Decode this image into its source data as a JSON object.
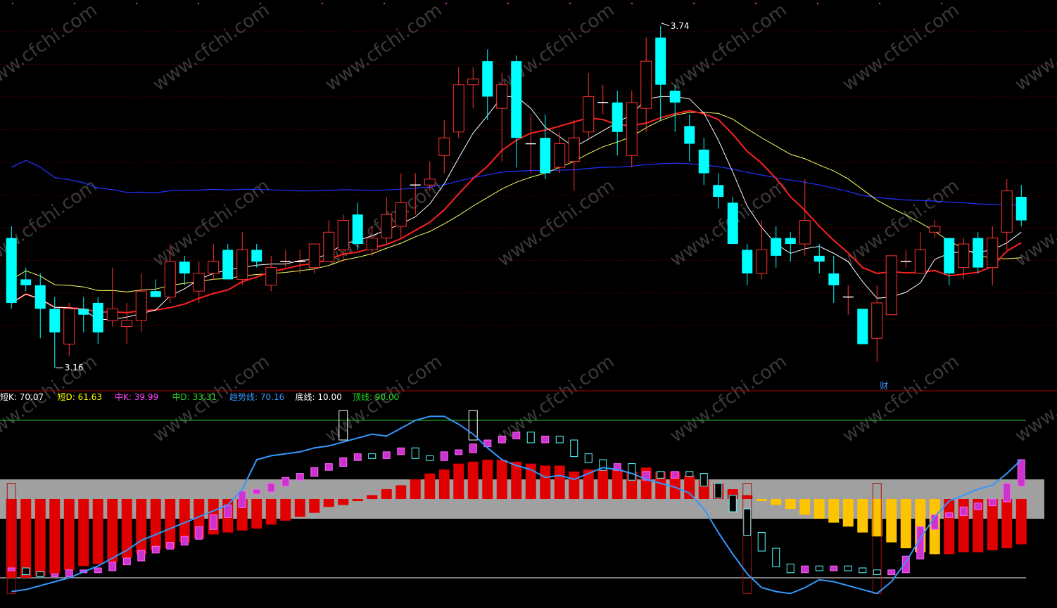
{
  "price_panel": {
    "high_label": "3.74",
    "low_label": "3.16",
    "event_marker": "财"
  },
  "indicator_legend": [
    {
      "name": "短K",
      "value": "70.07",
      "color": "#ffffff"
    },
    {
      "name": "短D",
      "value": "61.63",
      "color": "#ffff00"
    },
    {
      "name": "中K",
      "value": "39.99",
      "color": "#ff44ff"
    },
    {
      "name": "中D",
      "value": "33.31",
      "color": "#22dd22"
    },
    {
      "name": "趋势线",
      "value": "70.16",
      "color": "#3399ff"
    },
    {
      "name": "底线",
      "value": "10.00",
      "color": "#ffffff"
    },
    {
      "name": "顶线",
      "value": "90.00",
      "color": "#22dd22"
    }
  ],
  "watermark": "www.cfchi.com",
  "colors": {
    "up": "#ff3333",
    "down": "#00ffff",
    "ma_fast": "#ffffff",
    "ma_mid": "#ff2020",
    "ma_slow": "#ffff66",
    "ma_long": "#2233ff",
    "band": "#a0a0a0",
    "top_line": "#22cc22",
    "bottom_line": "#ffffff",
    "trend": "#3399ff",
    "grid": "#aa0000"
  },
  "chart_data": [
    {
      "type": "candlestick",
      "name": "price",
      "series": [
        {
          "o": 3.38,
          "c": 3.27,
          "h": 3.4,
          "l": 3.26
        },
        {
          "o": 3.31,
          "c": 3.3,
          "h": 3.33,
          "l": 3.29
        },
        {
          "o": 3.3,
          "c": 3.26,
          "h": 3.32,
          "l": 3.21
        },
        {
          "o": 3.26,
          "c": 3.22,
          "h": 3.28,
          "l": 3.16
        },
        {
          "o": 3.2,
          "c": 3.26,
          "h": 3.27,
          "l": 3.18
        },
        {
          "o": 3.26,
          "c": 3.25,
          "h": 3.28,
          "l": 3.22
        },
        {
          "o": 3.27,
          "c": 3.22,
          "h": 3.28,
          "l": 3.2
        },
        {
          "o": 3.24,
          "c": 3.26,
          "h": 3.33,
          "l": 3.23
        },
        {
          "o": 3.23,
          "c": 3.24,
          "h": 3.27,
          "l": 3.2
        },
        {
          "o": 3.24,
          "c": 3.29,
          "h": 3.32,
          "l": 3.22
        },
        {
          "o": 3.29,
          "c": 3.28,
          "h": 3.31,
          "l": 3.28
        },
        {
          "o": 3.28,
          "c": 3.34,
          "h": 3.37,
          "l": 3.27
        },
        {
          "o": 3.34,
          "c": 3.32,
          "h": 3.35,
          "l": 3.3
        },
        {
          "o": 3.29,
          "c": 3.32,
          "h": 3.34,
          "l": 3.27
        },
        {
          "o": 3.32,
          "c": 3.34,
          "h": 3.37,
          "l": 3.31
        },
        {
          "o": 3.36,
          "c": 3.31,
          "h": 3.37,
          "l": 3.31
        },
        {
          "o": 3.31,
          "c": 3.36,
          "h": 3.39,
          "l": 3.3
        },
        {
          "o": 3.36,
          "c": 3.34,
          "h": 3.37,
          "l": 3.33
        },
        {
          "o": 3.3,
          "c": 3.33,
          "h": 3.35,
          "l": 3.29
        },
        {
          "o": 3.34,
          "c": 3.34,
          "h": 3.36,
          "l": 3.33
        },
        {
          "o": 3.34,
          "c": 3.34,
          "h": 3.36,
          "l": 3.32
        },
        {
          "o": 3.33,
          "c": 3.37,
          "h": 3.37,
          "l": 3.32
        },
        {
          "o": 3.34,
          "c": 3.39,
          "h": 3.41,
          "l": 3.34
        },
        {
          "o": 3.36,
          "c": 3.41,
          "h": 3.42,
          "l": 3.34
        },
        {
          "o": 3.42,
          "c": 3.37,
          "h": 3.44,
          "l": 3.36
        },
        {
          "o": 3.36,
          "c": 3.38,
          "h": 3.4,
          "l": 3.35
        },
        {
          "o": 3.38,
          "c": 3.42,
          "h": 3.45,
          "l": 3.37
        },
        {
          "o": 3.4,
          "c": 3.44,
          "h": 3.49,
          "l": 3.38
        },
        {
          "o": 3.47,
          "c": 3.47,
          "h": 3.49,
          "l": 3.42
        },
        {
          "o": 3.47,
          "c": 3.48,
          "h": 3.51,
          "l": 3.46
        },
        {
          "o": 3.52,
          "c": 3.55,
          "h": 3.58,
          "l": 3.49
        },
        {
          "o": 3.56,
          "c": 3.64,
          "h": 3.67,
          "l": 3.55
        },
        {
          "o": 3.64,
          "c": 3.65,
          "h": 3.67,
          "l": 3.6
        },
        {
          "o": 3.68,
          "c": 3.62,
          "h": 3.7,
          "l": 3.58
        },
        {
          "o": 3.6,
          "c": 3.64,
          "h": 3.66,
          "l": 3.51
        },
        {
          "o": 3.68,
          "c": 3.55,
          "h": 3.69,
          "l": 3.5
        },
        {
          "o": 3.54,
          "c": 3.54,
          "h": 3.59,
          "l": 3.49
        },
        {
          "o": 3.55,
          "c": 3.49,
          "h": 3.59,
          "l": 3.48
        },
        {
          "o": 3.5,
          "c": 3.54,
          "h": 3.56,
          "l": 3.49
        },
        {
          "o": 3.51,
          "c": 3.55,
          "h": 3.58,
          "l": 3.46
        },
        {
          "o": 3.56,
          "c": 3.62,
          "h": 3.66,
          "l": 3.55
        },
        {
          "o": 3.61,
          "c": 3.61,
          "h": 3.64,
          "l": 3.59
        },
        {
          "o": 3.61,
          "c": 3.56,
          "h": 3.63,
          "l": 3.52
        },
        {
          "o": 3.52,
          "c": 3.61,
          "h": 3.63,
          "l": 3.5
        },
        {
          "o": 3.6,
          "c": 3.68,
          "h": 3.72,
          "l": 3.56
        },
        {
          "o": 3.72,
          "c": 3.64,
          "h": 3.74,
          "l": 3.58
        },
        {
          "o": 3.63,
          "c": 3.61,
          "h": 3.64,
          "l": 3.56
        },
        {
          "o": 3.57,
          "c": 3.54,
          "h": 3.59,
          "l": 3.51
        },
        {
          "o": 3.53,
          "c": 3.49,
          "h": 3.55,
          "l": 3.47
        },
        {
          "o": 3.47,
          "c": 3.45,
          "h": 3.49,
          "l": 3.43
        },
        {
          "o": 3.44,
          "c": 3.37,
          "h": 3.45,
          "l": 3.37
        },
        {
          "o": 3.36,
          "c": 3.32,
          "h": 3.37,
          "l": 3.3
        },
        {
          "o": 3.32,
          "c": 3.36,
          "h": 3.41,
          "l": 3.31
        },
        {
          "o": 3.38,
          "c": 3.35,
          "h": 3.4,
          "l": 3.33
        },
        {
          "o": 3.38,
          "c": 3.37,
          "h": 3.39,
          "l": 3.34
        },
        {
          "o": 3.37,
          "c": 3.41,
          "h": 3.48,
          "l": 3.35
        },
        {
          "o": 3.35,
          "c": 3.34,
          "h": 3.37,
          "l": 3.32
        },
        {
          "o": 3.32,
          "c": 3.3,
          "h": 3.35,
          "l": 3.27
        },
        {
          "o": 3.28,
          "c": 3.28,
          "h": 3.3,
          "l": 3.25
        },
        {
          "o": 3.26,
          "c": 3.2,
          "h": 3.26,
          "l": 3.2
        },
        {
          "o": 3.21,
          "c": 3.27,
          "h": 3.3,
          "l": 3.17
        },
        {
          "o": 3.25,
          "c": 3.35,
          "h": 3.35,
          "l": 3.25
        },
        {
          "o": 3.34,
          "c": 3.34,
          "h": 3.36,
          "l": 3.33
        },
        {
          "o": 3.32,
          "c": 3.36,
          "h": 3.39,
          "l": 3.32
        },
        {
          "o": 3.39,
          "c": 3.4,
          "h": 3.41,
          "l": 3.38
        },
        {
          "o": 3.38,
          "c": 3.32,
          "h": 3.38,
          "l": 3.3
        },
        {
          "o": 3.33,
          "c": 3.37,
          "h": 3.38,
          "l": 3.31
        },
        {
          "o": 3.38,
          "c": 3.33,
          "h": 3.39,
          "l": 3.32
        },
        {
          "o": 3.33,
          "c": 3.38,
          "h": 3.4,
          "l": 3.3
        },
        {
          "o": 3.39,
          "c": 3.46,
          "h": 3.48,
          "l": 3.36
        },
        {
          "o": 3.45,
          "c": 3.41,
          "h": 3.47,
          "l": 3.4
        }
      ],
      "overlays": [
        "MA5",
        "MA10",
        "MA20",
        "MA60"
      ],
      "y_range_hint": [
        3.16,
        3.74
      ]
    },
    {
      "type": "bar",
      "name": "oscillator",
      "reference_lines": {
        "bottom": 10.0,
        "top": 90.0
      },
      "band": [
        40,
        60
      ],
      "values_kd_short": [
        15,
        13,
        12,
        12,
        14,
        14,
        15,
        18,
        20,
        24,
        26,
        28,
        31,
        36,
        42,
        47,
        54,
        55,
        58,
        61,
        63,
        66,
        68,
        71,
        73,
        72,
        74,
        76,
        72,
        71,
        74,
        75,
        78,
        80,
        82,
        84,
        80,
        82,
        80,
        73,
        70,
        66,
        68,
        61,
        64,
        62,
        64,
        63,
        58,
        52,
        45,
        33,
        25,
        17,
        14,
        16,
        15,
        16,
        15,
        14,
        13,
        14,
        21,
        36,
        42,
        43,
        46,
        48,
        50,
        58,
        70
      ],
      "values_kd_mid": [
        10,
        10,
        11,
        12,
        14,
        16,
        17,
        18,
        20,
        22,
        24,
        25,
        28,
        30,
        32,
        33,
        34,
        35,
        37,
        39,
        41,
        43,
        46,
        47,
        49,
        52,
        55,
        57,
        60,
        63,
        65,
        68,
        69,
        70,
        70,
        69,
        68,
        67,
        67,
        64,
        65,
        65,
        65,
        64,
        66,
        64,
        64,
        62,
        60,
        58,
        55,
        52,
        49,
        47,
        45,
        42,
        40,
        38,
        36,
        33,
        31,
        28,
        25,
        23,
        22,
        22,
        23,
        23,
        24,
        25,
        27
      ],
      "values_trend": [
        3,
        4,
        6,
        8,
        10,
        13,
        16,
        20,
        24,
        29,
        32,
        35,
        38,
        41,
        44,
        47,
        55,
        70,
        72,
        73,
        74,
        76,
        77,
        79,
        81,
        83,
        82,
        86,
        90,
        92,
        92,
        88,
        83,
        76,
        70,
        67,
        65,
        61,
        62,
        60,
        63,
        66,
        65,
        63,
        60,
        58,
        56,
        53,
        45,
        33,
        22,
        12,
        5,
        3,
        2,
        5,
        9,
        8,
        6,
        4,
        2,
        8,
        18,
        30,
        41,
        49,
        52,
        55,
        57,
        63,
        70
      ]
    }
  ]
}
